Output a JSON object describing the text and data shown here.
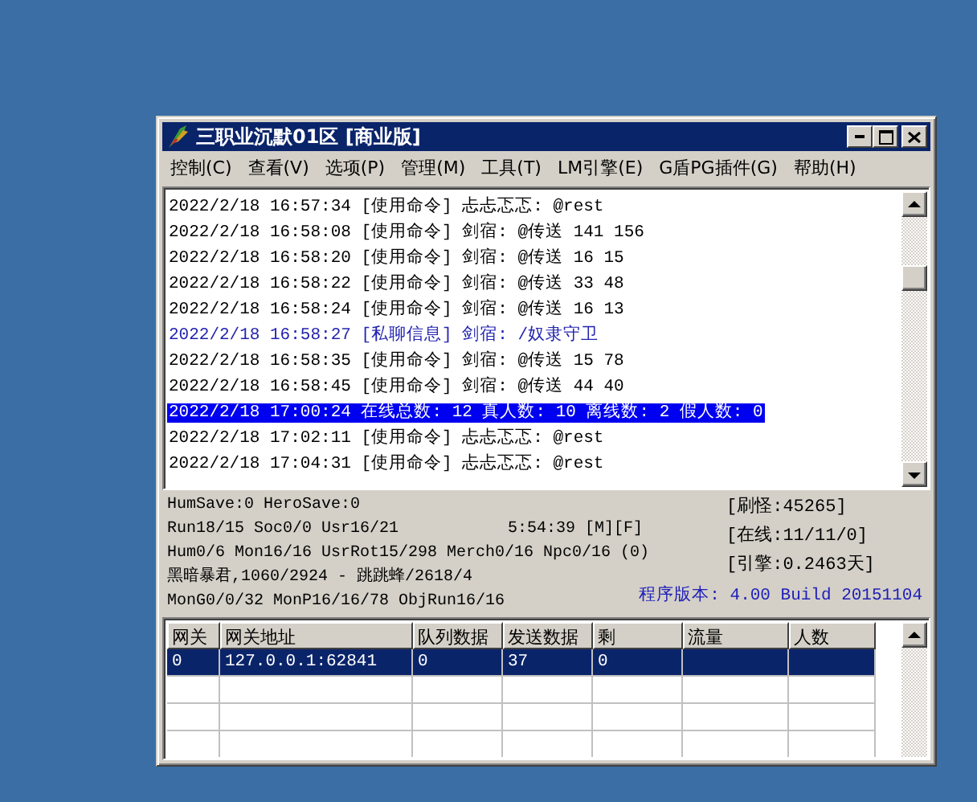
{
  "window": {
    "title": "三职业沉默01区 [商业版]"
  },
  "menu": [
    "控制(C)",
    "查看(V)",
    "选项(P)",
    "管理(M)",
    "工具(T)",
    "LM引擎(E)",
    "G盾PG插件(G)",
    "帮助(H)"
  ],
  "log": {
    "lines": [
      {
        "text": "2022/2/18 16:57:34 [使用命令] 忐忐忑忑: @rest",
        "kind": "command",
        "selected": false
      },
      {
        "text": "2022/2/18 16:58:08 [使用命令] 剑宿: @传送 141 156",
        "kind": "command",
        "selected": false
      },
      {
        "text": "2022/2/18 16:58:20 [使用命令] 剑宿: @传送 16 15",
        "kind": "command",
        "selected": false
      },
      {
        "text": "2022/2/18 16:58:22 [使用命令] 剑宿: @传送 33 48",
        "kind": "command",
        "selected": false
      },
      {
        "text": "2022/2/18 16:58:24 [使用命令] 剑宿: @传送 16 13",
        "kind": "command",
        "selected": false
      },
      {
        "text": "2022/2/18 16:58:27 [私聊信息] 剑宿: /奴隶守卫",
        "kind": "private",
        "selected": false
      },
      {
        "text": "2022/2/18 16:58:35 [使用命令] 剑宿: @传送 15 78",
        "kind": "command",
        "selected": false
      },
      {
        "text": "2022/2/18 16:58:45 [使用命令] 剑宿: @传送 44 40",
        "kind": "command",
        "selected": false
      },
      {
        "text": "2022/2/18 17:00:24 在线总数: 12 真人数: 10 离线数: 2 假人数: 0",
        "kind": "system",
        "selected": true
      },
      {
        "text": "2022/2/18 17:02:11 [使用命令] 忐忐忑忑: @rest",
        "kind": "command",
        "selected": false
      },
      {
        "text": "2022/2/18 17:04:31 [使用命令] 忐忐忑忑: @rest",
        "kind": "command",
        "selected": false
      }
    ]
  },
  "status": {
    "lines": [
      {
        "text": "HumSave:0 HeroSave:0"
      },
      {
        "text": "Run18/15 Soc0/0 Usr16/21",
        "aside": "5:54:39 [M][F]"
      },
      {
        "text": "Hum0/6 Mon16/16 UsrRot15/298 Merch0/16 Npc0/16 (0)"
      },
      {
        "text": "黑暗暴君,1060/2924 - 跳跳蜂/2618/4"
      },
      {
        "text": "MonG0/0/32 MonP16/16/78 ObjRun16/16"
      }
    ],
    "counters": [
      "[刷怪:45265]",
      "[在线:11/11/0]",
      "[引擎:0.2463天]"
    ],
    "version": "程序版本: 4.00 Build 20151104"
  },
  "table": {
    "columns": [
      "网关",
      "网关地址",
      "队列数据",
      "发送数据",
      "剩",
      "流量",
      "人数"
    ],
    "rows": [
      {
        "cells": [
          "0",
          "127.0.0.1:62841",
          "0",
          "37",
          "0",
          "",
          ""
        ],
        "selected": true
      }
    ]
  }
}
